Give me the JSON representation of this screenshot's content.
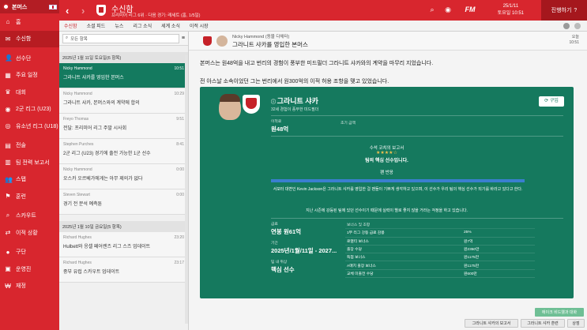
{
  "sidebar": {
    "header": "본머스",
    "items": [
      {
        "icon": "home-icon",
        "glyph": "⌂",
        "label": "홈"
      },
      {
        "icon": "inbox-icon",
        "glyph": "✉",
        "label": "수신함"
      },
      {
        "icon": "squad-icon",
        "glyph": "👤",
        "label": "선수단"
      },
      {
        "icon": "calendar-icon",
        "glyph": "▦",
        "label": "주요 일정"
      },
      {
        "icon": "trophy-icon",
        "glyph": "♛",
        "label": "대회"
      },
      {
        "icon": "reserve-icon",
        "glyph": "◉",
        "label": "2군 리그 (U23)"
      },
      {
        "icon": "youth-icon",
        "glyph": "◎",
        "label": "유소년 리그 (U18)"
      },
      {
        "icon": "tactics-icon",
        "glyph": "▤",
        "label": "전술"
      },
      {
        "icon": "report-icon",
        "glyph": "▥",
        "label": "팀 전력 보고서"
      },
      {
        "icon": "staff-icon",
        "glyph": "👥",
        "label": "스탭"
      },
      {
        "icon": "training-icon",
        "glyph": "⚑",
        "label": "훈련"
      },
      {
        "icon": "scouting-icon",
        "glyph": "⌕",
        "label": "스카우트"
      },
      {
        "icon": "transfer-icon",
        "glyph": "⇄",
        "label": "이적 상황"
      },
      {
        "icon": "club-icon",
        "glyph": "●",
        "label": "구단"
      },
      {
        "icon": "board-icon",
        "glyph": "▣",
        "label": "운영진"
      },
      {
        "icon": "finance-icon",
        "glyph": "₩",
        "label": "재정"
      }
    ]
  },
  "topbar": {
    "title": "수신함",
    "subtitle": "프리미어 리그 6위 · 다음 경기: 레세트 (홈, 1/5일)",
    "date_line1": "25/1/11",
    "date_line2": "토요일 10:51",
    "next_button": "진행하기"
  },
  "subtabs": [
    "수신함",
    "소셜 피드",
    "뉴스",
    "리그 소식",
    "세계 소식",
    "이적 시장"
  ],
  "message_list": {
    "search_placeholder": "모든 항목",
    "groups": [
      {
        "header": "2025년 1월 11일 토요일(6 항목)",
        "messages": [
          {
            "from": "Nicky Hammond",
            "subject": "그라니트 샤카를 영입한 본머스",
            "time": "10:51",
            "selected": true
          },
          {
            "from": "Nicky Hammond",
            "subject": "그라니트 샤카, 본머스와의 계약에 합의",
            "time": "10:29",
            "selected": false
          },
          {
            "from": "Freyo Thomas",
            "subject": "전달: 프리미어 리그 주말 시사회",
            "time": "9:51",
            "selected": false
          },
          {
            "from": "Stephen Purches",
            "subject": "2군 리그 (U23) 경기에 출전 가능한 1군 선수",
            "time": "8:41",
            "selected": false
          },
          {
            "from": "Nicky Hammond",
            "subject": "오스카 오르베가에게는 아무 제의가 없다",
            "time": "0:00",
            "selected": false
          },
          {
            "from": "Steven Stewart",
            "subject": "경기 전 분석 예측툰",
            "time": "0:00",
            "selected": false
          }
        ]
      },
      {
        "header": "2025년 1월 10일 금요일(5 항목)",
        "messages": [
          {
            "from": "Richard Hughes",
            "subject": "Hulbett와 응셀 페어렌즈 리그 스즈 업데이트",
            "time": "23:20",
            "selected": false
          },
          {
            "from": "Richard Hughes",
            "subject": "중부 유럽 스카우트 업데이트",
            "time": "23:17",
            "selected": false
          }
        ]
      }
    ]
  },
  "message": {
    "from": "Nicky Hammond (동물 다채터)",
    "subject": "그라니트 샤카를 영입한 본머스",
    "time_line1": "오늘",
    "time_line2": "10:51",
    "para1": "본머스는 원48억을 내고 번리의 경험이 풍부한 미드필더 그라니트 샤카와의 계약을 마무리 지었습니다.",
    "para2": "전 아스날 소속이었던 그는 번리에서 원300억의 이적 허용 조항을 맺고 있었습니다."
  },
  "card": {
    "player_name": "그라니트 샤카",
    "player_desc": "32세 경험이 풍부한 미드필더",
    "buy_label": "구입",
    "fee_label": "이적료",
    "fee_value": "원48억",
    "fee2_label": "초기 금액",
    "coach_report_label": "수석 코치의 보고서",
    "stars": 4,
    "stars_glyph": "★★★★☆",
    "coach_verdict": "팀의 핵심 선수입니다.",
    "fan_label": "팬 반응",
    "fan_text": "서포터 대변인 Kevin Jackson은 그라니트 샤카를 영입한 걸 팬들이 기쁘게 생각하고 있으며, 이 선수가 우리 팀의 핵심 선수가 되기를 바라고 있다고 한다.",
    "fan_text2": "지난 시즌에 강등된 팀에 있던 선수이기 때문에 실력이 별로 좋지 않을 거라는 걱정을 하고 있습니다.",
    "wage_label": "급료",
    "wage_value": "연봉 원61억",
    "contract_label": "기간",
    "contract_value": "2025년/1월/11일 - 2027...",
    "status_label": "팀 내 위상",
    "status_value": "핵심 선수",
    "bonus_header": "보너스 및 조항",
    "bonuses": [
      {
        "k": "1부 리그 강등 급료 감봉",
        "v": "25%"
      },
      {
        "k": "로열티 보너스",
        "v": "원7억"
      },
      {
        "k": "출장 수당",
        "v": "원2350만"
      },
      {
        "k": "득점 보너스",
        "v": "원1175만"
      },
      {
        "k": "A매치 출장 보너스",
        "v": "원1175만"
      },
      {
        "k": "교체 미출전 수당",
        "v": "원600만"
      }
    ]
  },
  "bottom": {
    "green_button": "에이크 비드웰과 대화",
    "btn1": "그라니트 샤카의 보고서",
    "btn2": "그라니트 샤카 훈련",
    "btn3": "상점"
  }
}
